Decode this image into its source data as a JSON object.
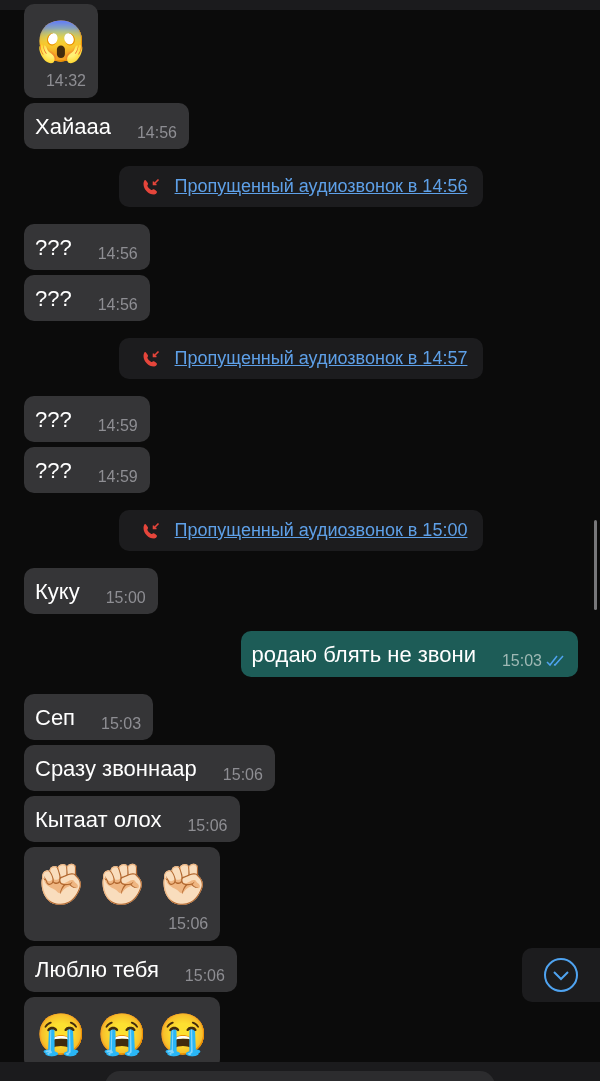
{
  "messages": [
    {
      "kind": "emoji",
      "text": "😱",
      "time": "14:32"
    },
    {
      "kind": "incoming",
      "text": "Хайааа",
      "time": "14:56"
    },
    {
      "kind": "call",
      "text": "Пропущенный аудиозвонок в 14:56"
    },
    {
      "kind": "incoming",
      "text": "???",
      "time": "14:56"
    },
    {
      "kind": "incoming",
      "text": "???",
      "time": "14:56"
    },
    {
      "kind": "call",
      "text": "Пропущенный аудиозвонок в 14:57"
    },
    {
      "kind": "incoming",
      "text": "???",
      "time": "14:59"
    },
    {
      "kind": "incoming",
      "text": "???",
      "time": "14:59"
    },
    {
      "kind": "call",
      "text": "Пропущенный аудиозвонок в 15:00"
    },
    {
      "kind": "incoming",
      "text": "Куку",
      "time": "15:00"
    },
    {
      "kind": "outgoing",
      "text": "родаю блять не звони",
      "time": "15:03",
      "read": true
    },
    {
      "kind": "incoming",
      "text": "Сеп",
      "time": "15:03"
    },
    {
      "kind": "incoming",
      "text": "Сразу звоннаар",
      "time": "15:06"
    },
    {
      "kind": "incoming",
      "text": "Кытаат олох",
      "time": "15:06"
    },
    {
      "kind": "emoji",
      "text": "✊🏻 ✊🏻 ✊🏻",
      "time": "15:06"
    },
    {
      "kind": "incoming",
      "text": "Люблю тебя",
      "time": "15:06"
    },
    {
      "kind": "emoji",
      "text": "😭 😭 😭"
    }
  ]
}
